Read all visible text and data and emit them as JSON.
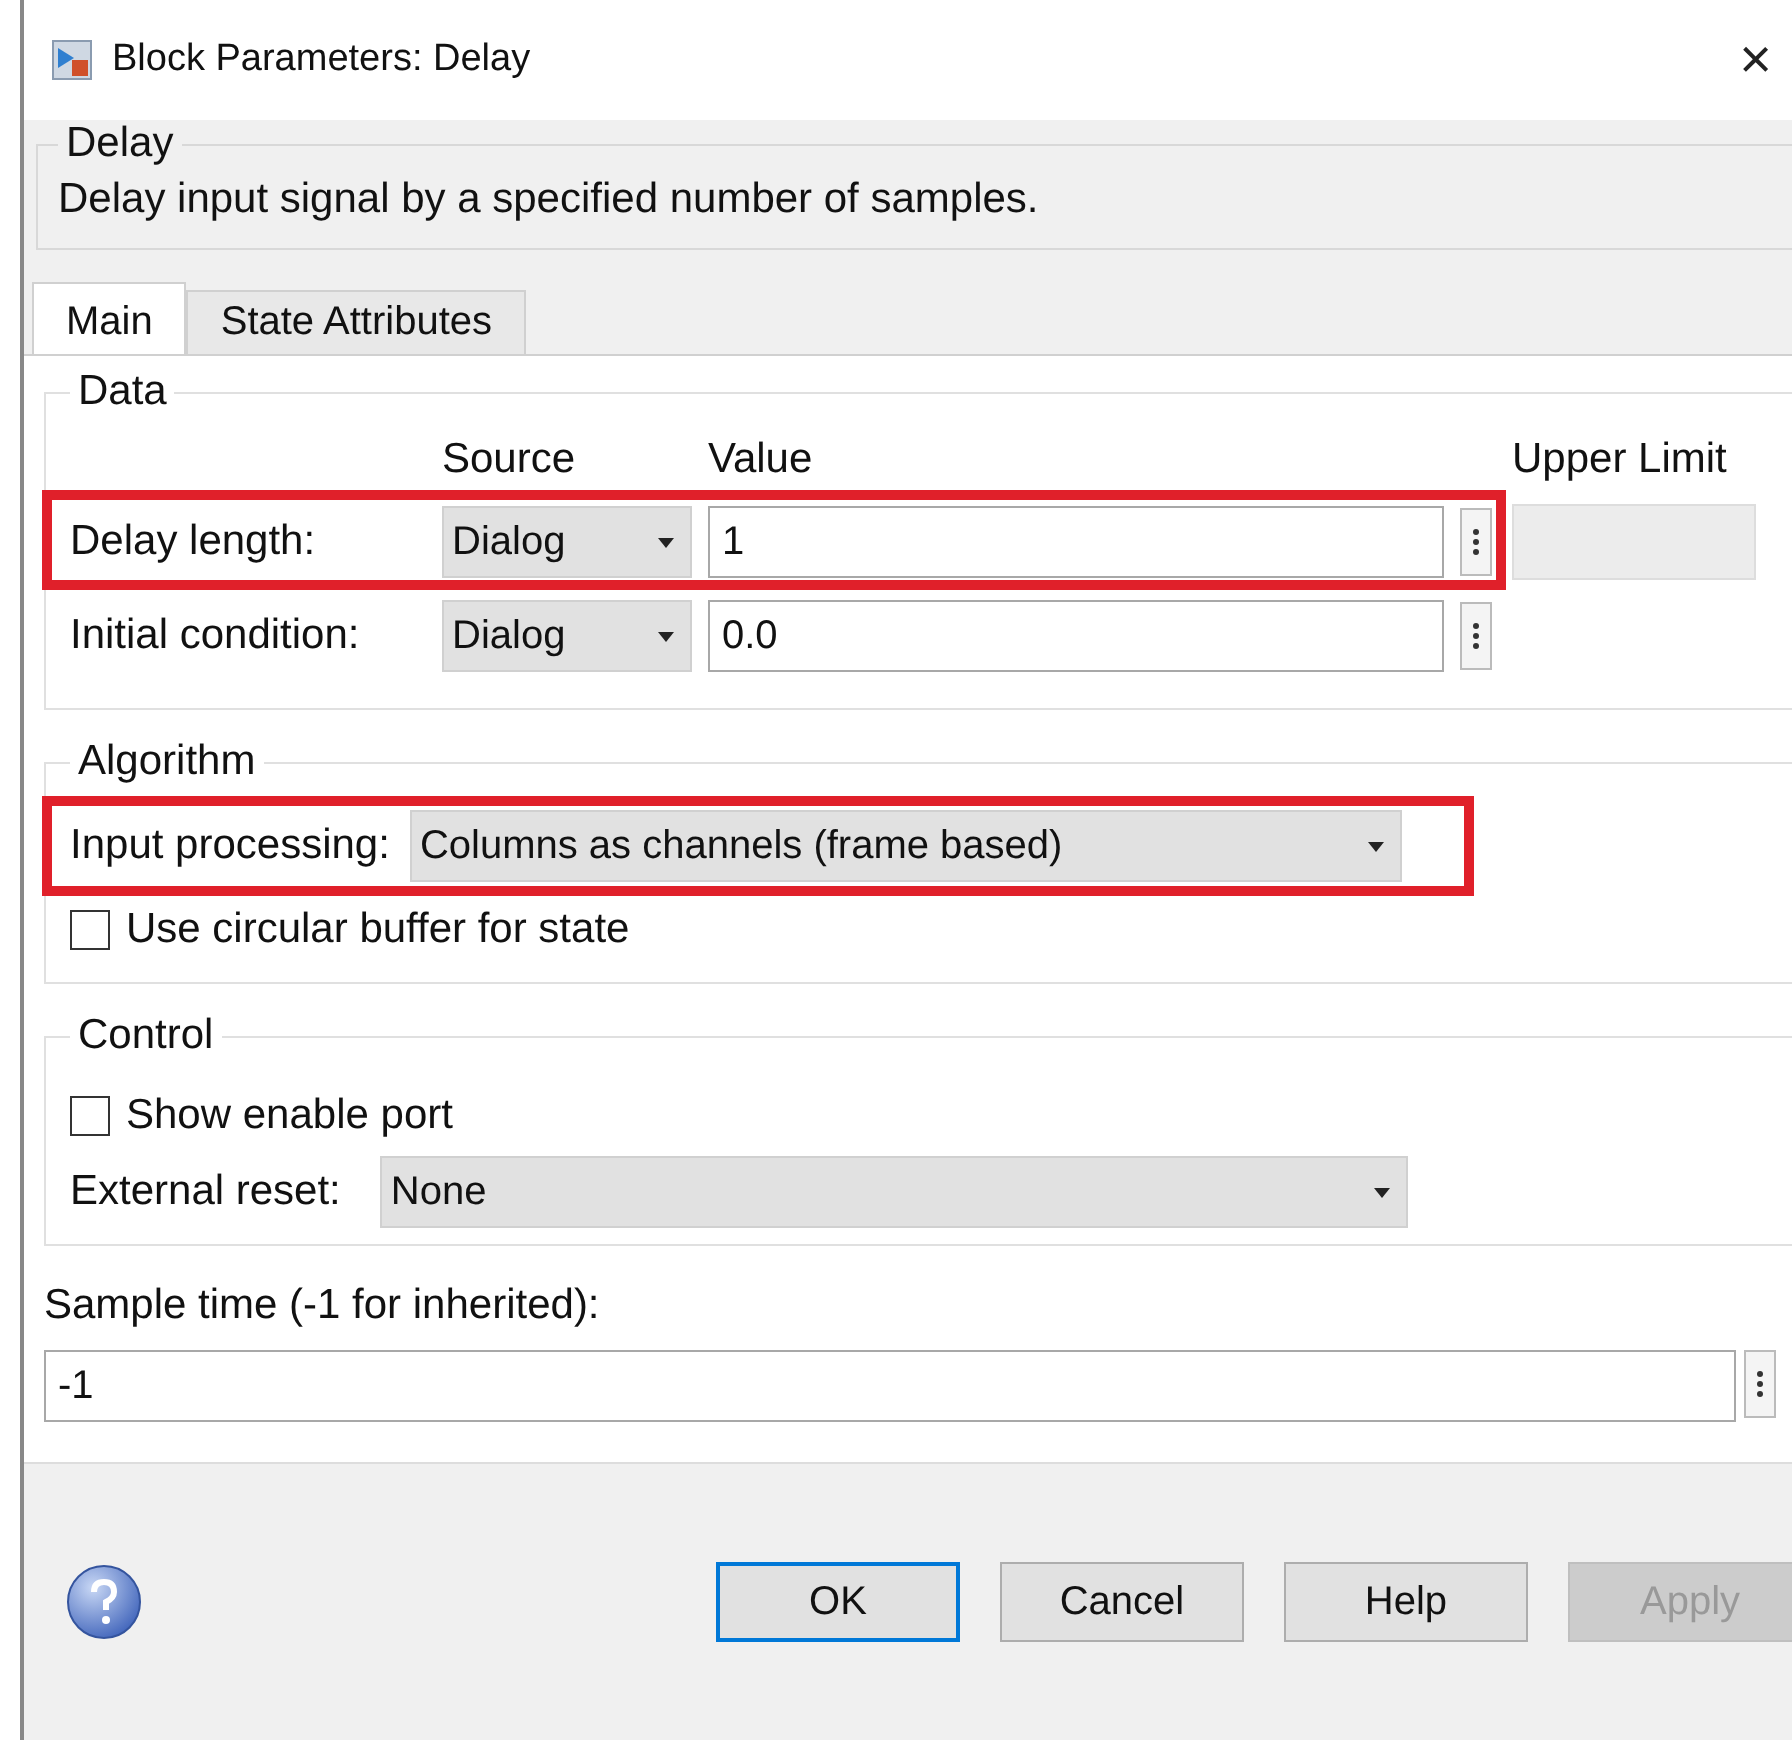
{
  "window": {
    "title": "Block Parameters: Delay",
    "close": "×"
  },
  "header": {
    "title": "Delay",
    "description": "Delay input signal by a specified number of samples."
  },
  "tabs": [
    {
      "label": "Main",
      "selected": true
    },
    {
      "label": "State Attributes",
      "selected": false
    }
  ],
  "data": {
    "title": "Data",
    "columns": [
      "Source",
      "Value",
      "Upper Limit"
    ],
    "rows": [
      {
        "label": "Delay length:",
        "source": "Dialog",
        "value": "1",
        "highlighted": true,
        "has_upper_limit": true
      },
      {
        "label": "Initial condition:",
        "source": "Dialog",
        "value": "0.0",
        "highlighted": false,
        "has_upper_limit": false
      }
    ]
  },
  "algorithm": {
    "title": "Algorithm",
    "input_processing": {
      "label": "Input processing:",
      "value": "Columns as channels (frame based)",
      "highlighted": true
    },
    "circular_buffer": {
      "label": "Use circular buffer for state",
      "checked": false
    }
  },
  "control": {
    "title": "Control",
    "enable_port": {
      "label": "Show enable port",
      "checked": false
    },
    "external_reset": {
      "label": "External reset:",
      "value": "None"
    }
  },
  "sample_time": {
    "label": "Sample time (-1 for inherited):",
    "value": "-1"
  },
  "buttons": [
    {
      "label": "OK",
      "default": true,
      "disabled": false
    },
    {
      "label": "Cancel",
      "default": false,
      "disabled": false
    },
    {
      "label": "Help",
      "default": false,
      "disabled": false
    },
    {
      "label": "Apply",
      "default": false,
      "disabled": true
    }
  ]
}
